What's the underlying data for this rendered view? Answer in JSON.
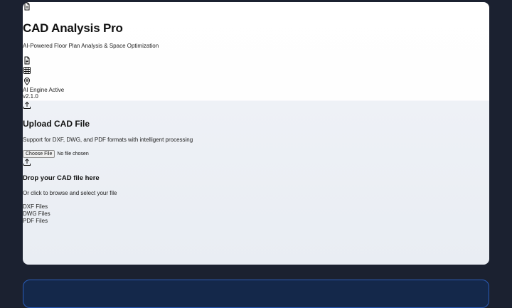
{
  "app": {
    "title": "CAD Analysis Pro",
    "subtitle": "AI-Powered Floor Plan Analysis & Space Optimization"
  },
  "header_icons": [
    "document-icon",
    "grid-icon",
    "location-pin-icon"
  ],
  "status": {
    "engine": "AI Engine Active",
    "version": "v2.1.0"
  },
  "upload": {
    "heading": "Upload CAD File",
    "description": "Support for DXF, DWG, and PDF formats with intelligent processing",
    "choose_label": "Choose File",
    "no_file_text": "No file chosen"
  },
  "dropzone": {
    "title": "Drop your CAD file here",
    "subtitle": "Or click to browse and select your file",
    "formats": [
      "DXF Files",
      "DWG Files",
      "PDF Files"
    ]
  },
  "colors": {
    "page_bg": "#1b2130",
    "card_top": "#ffffff",
    "card_bottom": "#e9edf3",
    "accent_border": "#2a5cb8"
  }
}
